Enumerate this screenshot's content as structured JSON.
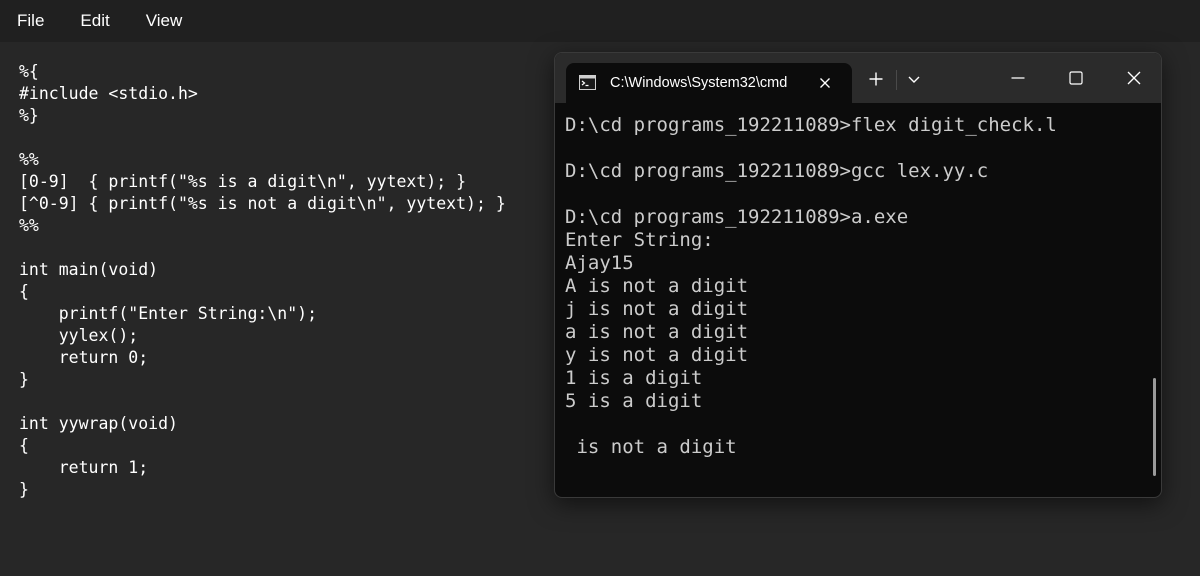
{
  "notepad": {
    "menu": [
      "File",
      "Edit",
      "View"
    ],
    "code_lines": [
      "%{",
      "#include <stdio.h>",
      "%}",
      "",
      "%%",
      "[0-9]  { printf(\"%s is a digit\\n\", yytext); }",
      "[^0-9] { printf(\"%s is not a digit\\n\", yytext); }",
      "%%",
      "",
      "int main(void)",
      "{",
      "    printf(\"Enter String:\\n\");",
      "    yylex();",
      "    return 0;",
      "}",
      "",
      "int yywrap(void)",
      "{",
      "    return 1;",
      "}"
    ]
  },
  "terminal": {
    "tab_title": "C:\\Windows\\System32\\cmd",
    "icons": {
      "tab": "cmd-icon",
      "tab_close": "close-icon",
      "new_tab": "plus-icon",
      "dropdown": "chevron-down-icon",
      "minimize": "minimize-icon",
      "maximize": "maximize-icon",
      "close": "close-icon"
    },
    "output_lines": [
      "D:\\cd programs_192211089>flex digit_check.l",
      "",
      "D:\\cd programs_192211089>gcc lex.yy.c",
      "",
      "D:\\cd programs_192211089>a.exe",
      "Enter String:",
      "Ajay15",
      "A is not a digit",
      "j is not a digit",
      "a is not a digit",
      "y is not a digit",
      "1 is a digit",
      "5 is a digit",
      "",
      " is not a digit"
    ]
  },
  "colors": {
    "editor_bg": "#272727",
    "menubar_bg": "#202020",
    "terminal_bg": "#0c0c0c",
    "titlebar_bg": "#2b2b2b",
    "terminal_text": "#cccccc"
  }
}
